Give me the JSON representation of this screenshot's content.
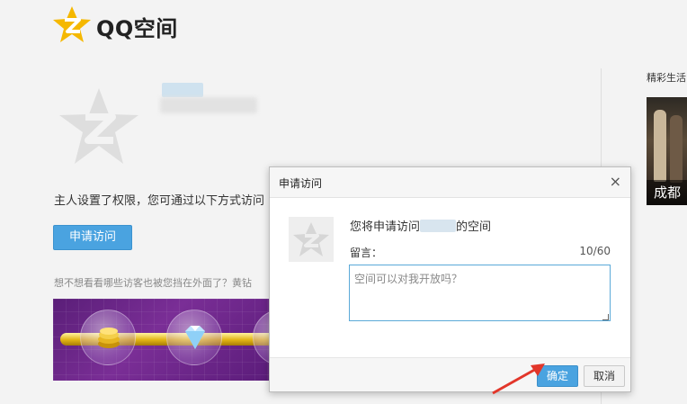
{
  "header": {
    "brand": "QQ空间"
  },
  "main": {
    "permission_text": "主人设置了权限，您可通过以下方式访问",
    "apply_button": "申请访问",
    "hint_text": "想不想看看哪些访客也被您挡在外面了？黄钻",
    "name_blurred": ""
  },
  "sidebar": {
    "title": "精彩生活",
    "image_caption": "成都"
  },
  "dialog": {
    "title": "申请访问",
    "close_glyph": "×",
    "message_prefix": "您将申请访问",
    "message_suffix": "的空间",
    "message_label": "留言：",
    "char_count": "10/60",
    "textarea_value": "空间可以对我开放吗？",
    "ok_label": "确定",
    "cancel_label": "取消"
  },
  "colors": {
    "accent": "#4aa3e0",
    "logo_star": "#f5b800",
    "arrow": "#e2362a"
  },
  "icons": [
    "qzone-star-logo-icon",
    "default-avatar-icon",
    "close-icon",
    "resize-grip-icon",
    "red-arrow-annotation"
  ]
}
